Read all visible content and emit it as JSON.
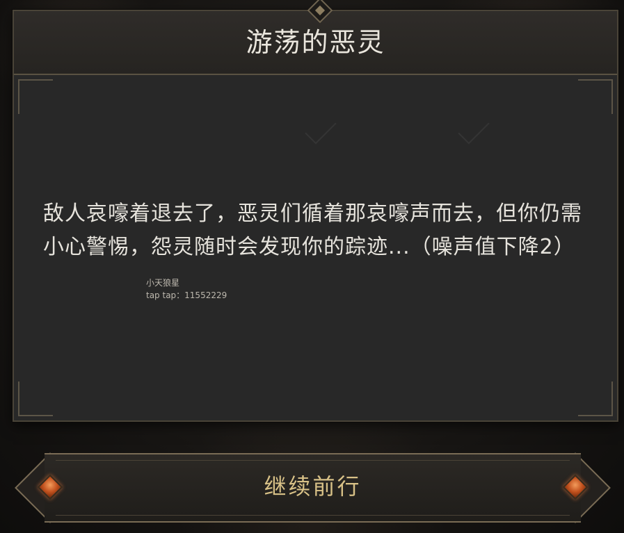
{
  "dialog": {
    "title": "游荡的恶灵",
    "body_text": "敌人哀嚎着退去了，恶灵们循着那哀嚎声而去，但你仍需小心警惕，怨灵随时会发现你的踪迹...（噪声值下降2）",
    "signature_name": "小天狼星",
    "signature_id": "tap tap：11552229"
  },
  "actions": {
    "continue_label": "继续前行"
  },
  "colors": {
    "title_text": "#eae6dd",
    "body_text": "#e6e3dc",
    "button_text": "#d8c187",
    "panel_bg": "#282828",
    "frame": "#5a5243",
    "gem": "#c1501d"
  },
  "icons": {
    "title_ornament": "diamond-ornament-icon",
    "button_gems": "orange-gem-icon"
  }
}
